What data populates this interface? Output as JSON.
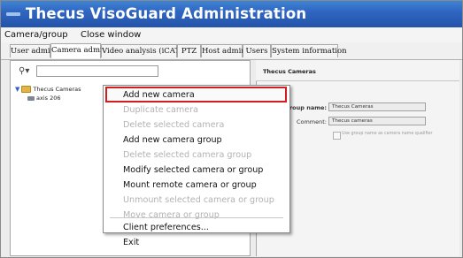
{
  "window": {
    "title": "Thecus VisoGuard Administration"
  },
  "menubar": {
    "items": [
      "Camera/group",
      "Close window"
    ]
  },
  "tabs": [
    {
      "label": "User admin"
    },
    {
      "label": "Camera admin",
      "active": true
    },
    {
      "label": "Video analysis (iCAT)"
    },
    {
      "label": "PTZ"
    },
    {
      "label": "Host admin"
    },
    {
      "label": "Users"
    },
    {
      "label": "System information"
    }
  ],
  "left_panel": {
    "search_value": "",
    "tree": {
      "root": "Thecus Cameras",
      "child": "axis 206"
    }
  },
  "right_panel": {
    "title": "Thecus Cameras",
    "group_name_label": "group name:",
    "group_name_value": "Thecus Cameras",
    "comment_label": "Comment:",
    "comment_value": "Thecus cameras",
    "checkbox_label": "Use group name as camera name qualifier"
  },
  "context_menu": {
    "items": [
      {
        "label": "Add new camera",
        "enabled": true,
        "highlighted": true
      },
      {
        "label": "Duplicate camera",
        "enabled": false
      },
      {
        "label": "Delete selected camera",
        "enabled": false
      },
      {
        "label": "Add new camera group",
        "enabled": true
      },
      {
        "label": "Delete selected camera group",
        "enabled": false
      },
      {
        "label": "Modify selected camera or group",
        "enabled": true
      },
      {
        "label": "Mount remote camera or group",
        "enabled": true
      },
      {
        "label": "Unmount selected camera or group",
        "enabled": false
      },
      {
        "label": "Move camera or group",
        "enabled": false
      },
      {
        "label": "Client preferences...",
        "enabled": true
      },
      {
        "label": "Exit",
        "enabled": true
      }
    ]
  },
  "colors": {
    "titlebar": "#2f66c2",
    "highlight_border": "#d41e1e",
    "disabled_text": "#b2b2b2"
  }
}
